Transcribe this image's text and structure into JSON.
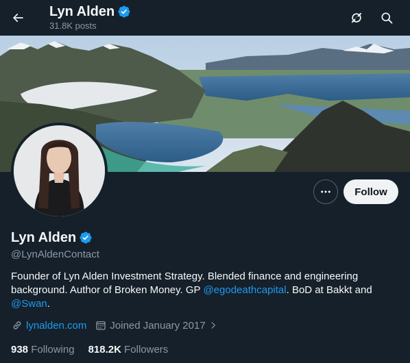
{
  "header": {
    "title": "Lyn Alden",
    "posts": "31.8K posts"
  },
  "profile": {
    "name": "Lyn Alden",
    "handle": "@LynAldenContact",
    "bio": {
      "part1": "Founder of Lyn Alden Investment Strategy. Blended finance and engineering background. Author of Broken Money. GP ",
      "mention1": "@egodeathcapital",
      "part2": ". BoD at Bakkt and ",
      "mention2": "@Swan",
      "part3": "."
    },
    "website": "lynalden.com",
    "joined": "Joined January 2017",
    "following_count": "938",
    "following_label": "Following",
    "followers_count": "818.2K",
    "followers_label": "Followers"
  },
  "actions": {
    "follow_label": "Follow"
  },
  "colors": {
    "background": "#15202b",
    "accent": "#1d9bf0",
    "secondary_text": "#8b98a5",
    "verified": "#1d9bf0"
  },
  "icons": {
    "back": "arrow-left-icon",
    "grok": "grok-icon",
    "search": "search-icon",
    "more": "more-icon",
    "verified": "verified-badge-icon",
    "link": "link-icon",
    "calendar": "calendar-icon",
    "chevron": "chevron-right-icon"
  }
}
